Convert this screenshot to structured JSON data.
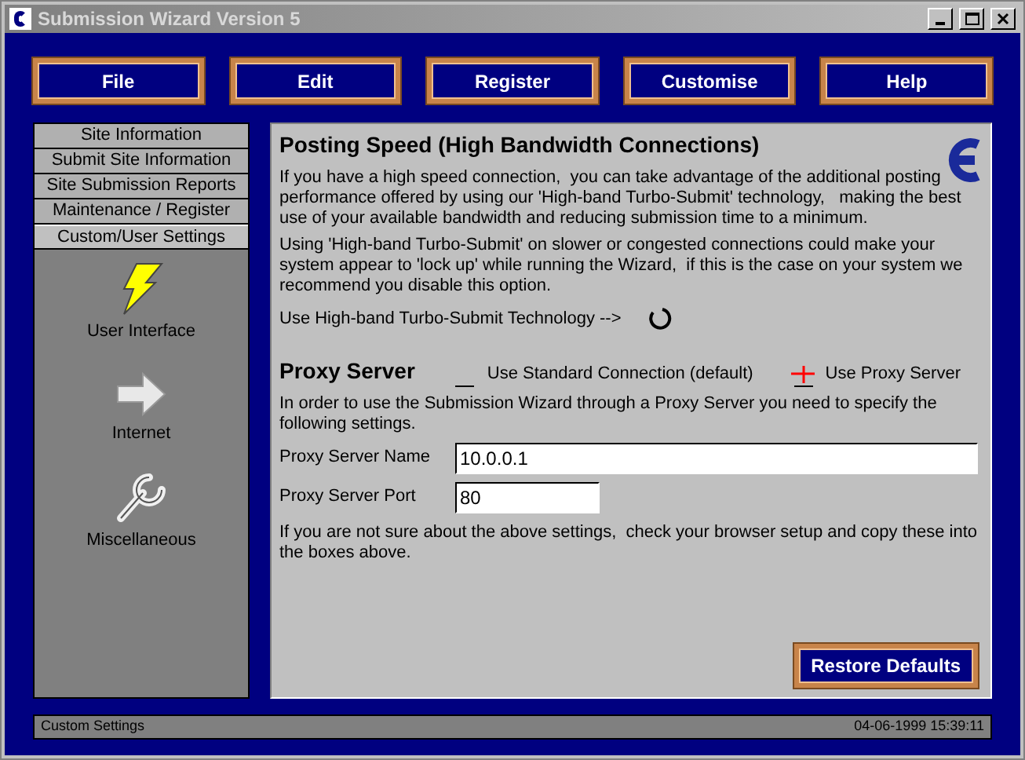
{
  "window": {
    "title": "Submission Wizard Version 5"
  },
  "menu": [
    "File",
    "Edit",
    "Register",
    "Customise",
    "Help"
  ],
  "sidebar": {
    "tabs": [
      {
        "label": "Site Information",
        "selected": false
      },
      {
        "label": "Submit Site Information",
        "selected": false
      },
      {
        "label": "Site Submission Reports",
        "selected": false
      },
      {
        "label": "Maintenance / Register",
        "selected": false
      },
      {
        "label": "Custom/User Settings",
        "selected": true
      }
    ],
    "items": [
      {
        "label": "User Interface",
        "kind": "lightning"
      },
      {
        "label": "Internet",
        "kind": "arrow"
      },
      {
        "label": "Miscellaneous",
        "kind": "wrench"
      }
    ]
  },
  "posting": {
    "title": "Posting Speed (High Bandwidth Connections)",
    "paragraphs": [
      "If you have a high speed connection,  you can take advantage of the additional posting performance offered by using our 'High-band Turbo-Submit' technology,   making the best use of your available bandwidth and reducing submission time to a minimum.",
      "Using 'High-band Turbo-Submit' on slower or congested connections could make your system appear to 'lock up' while running the Wizard,  if this is the case on your system we recommend you disable this option."
    ],
    "toggle_label": "Use High-band Turbo-Submit Technology -->"
  },
  "proxy": {
    "title": "Proxy Server",
    "options": [
      {
        "label": "Use Standard Connection (default)",
        "selected": false
      },
      {
        "label": "Use Proxy Server",
        "selected": true
      }
    ],
    "intro": "In order to use the Submission Wizard through a Proxy Server you need to specify the following settings.",
    "fields": [
      {
        "label": "Proxy Server Name",
        "value": "10.0.0.1",
        "wide": true
      },
      {
        "label": "Proxy Server Port",
        "value": "80",
        "wide": false
      }
    ],
    "note": "If you are not sure about the above settings,  check your browser setup and copy these into the boxes above."
  },
  "restore_button": "Restore Defaults",
  "status_bar": {
    "left": "Custom Settings",
    "right": "04-06-1999 15:39:11"
  }
}
